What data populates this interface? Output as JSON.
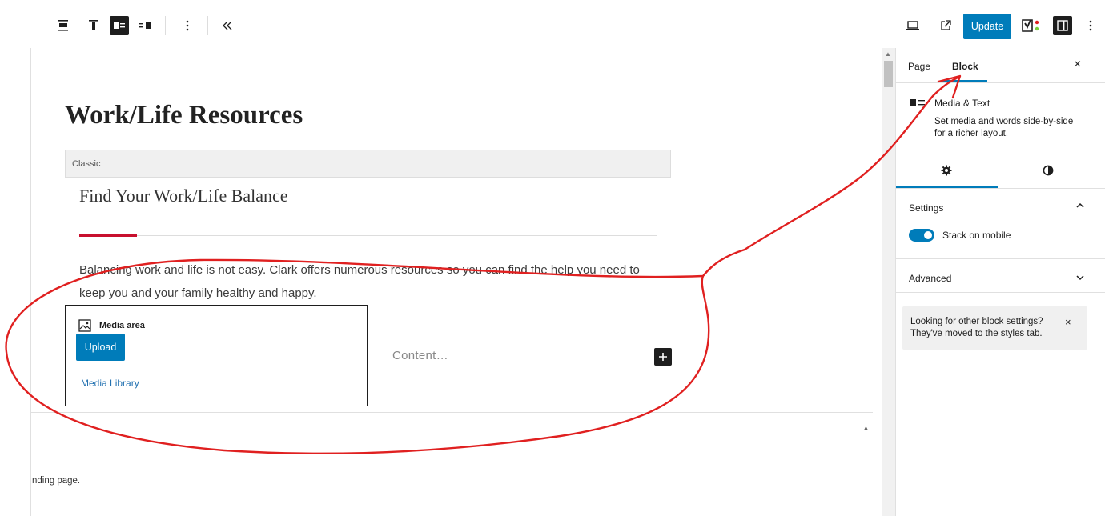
{
  "toolbar": {
    "buttons": [
      {
        "name": "align-none",
        "icon": "align-none-icon"
      },
      {
        "name": "align-top",
        "icon": "align-top-icon"
      },
      {
        "name": "media-left",
        "icon": "media-on-left-icon",
        "active": true
      },
      {
        "name": "media-right",
        "icon": "media-on-right-icon"
      }
    ],
    "more_icon": "ellipsis-vertical-icon",
    "collapse_icon": "double-chevron-left-icon",
    "update_label": "Update",
    "right_icons": [
      "desktop-preview-icon",
      "external-link-icon",
      "yoast-seo-icon",
      "sidebar-settings-icon",
      "ellipsis-vertical-icon"
    ]
  },
  "editor": {
    "page_title": "Work/Life Resources",
    "classic_label": "Classic",
    "subheading": "Find Your Work/Life Balance",
    "paragraph": "Balancing work and life is not easy. Clark offers numerous resources so you can find the help you need to keep you and your family healthy and happy.",
    "media": {
      "area_label": "Media area",
      "upload_label": "Upload",
      "library_label": "Media Library",
      "content_placeholder": "Content…"
    },
    "footer_text": "nding page."
  },
  "sidebar": {
    "tabs": [
      {
        "label": "Page",
        "active": false
      },
      {
        "label": "Block",
        "active": true
      }
    ],
    "close_label": "×",
    "block": {
      "title": "Media & Text",
      "description": "Set media and words side-by-side for a richer layout."
    },
    "subtabs": [
      {
        "icon": "gear-icon",
        "active": true
      },
      {
        "icon": "styles-contrast-icon",
        "active": false
      }
    ],
    "settings": {
      "title": "Settings",
      "toggle_label": "Stack on mobile",
      "toggle_on": true
    },
    "advanced": {
      "title": "Advanced"
    },
    "notice": {
      "text": "Looking for other block settings? They've moved to the styles tab.",
      "close_label": "×"
    }
  },
  "colors": {
    "accent": "#007cba",
    "annotation": "#e02020",
    "divider_red": "#c8102e"
  }
}
